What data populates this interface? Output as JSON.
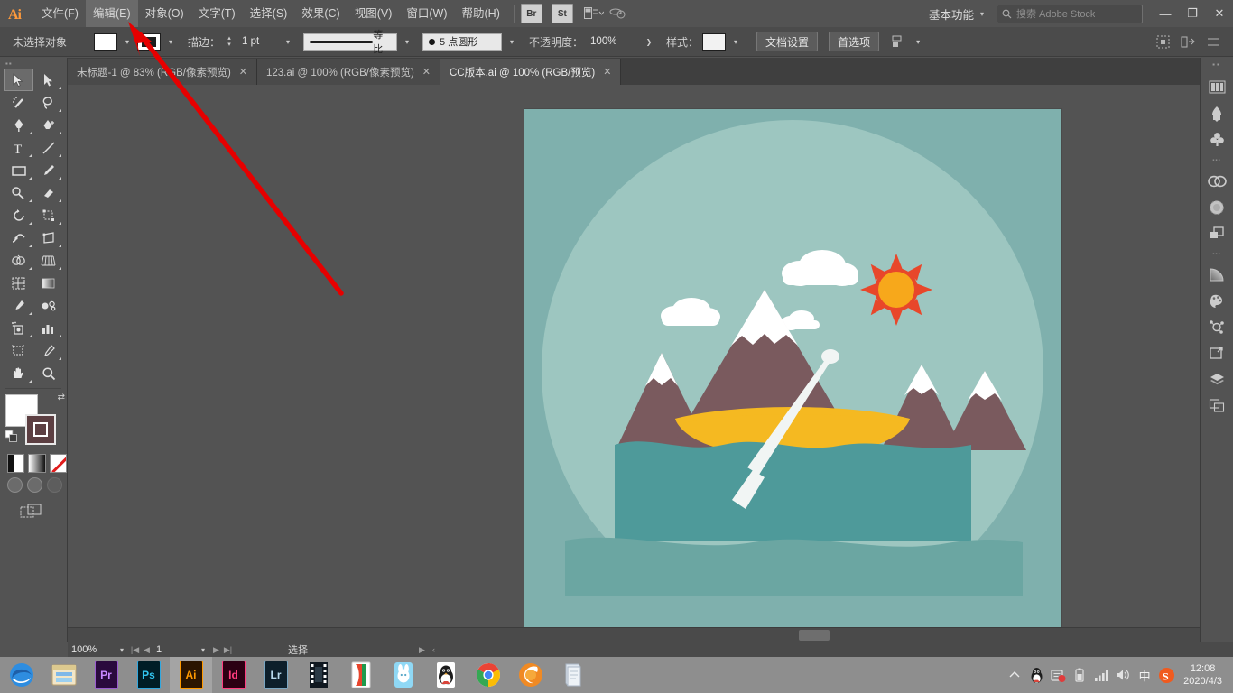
{
  "app": {
    "name": "Adobe Illustrator",
    "logo_text": "Ai"
  },
  "menubar": {
    "items": [
      {
        "label": "文件(F)",
        "highlighted": false
      },
      {
        "label": "编辑(E)",
        "highlighted": true
      },
      {
        "label": "对象(O)",
        "highlighted": false
      },
      {
        "label": "文字(T)",
        "highlighted": false
      },
      {
        "label": "选择(S)",
        "highlighted": false
      },
      {
        "label": "效果(C)",
        "highlighted": false
      },
      {
        "label": "视图(V)",
        "highlighted": false
      },
      {
        "label": "窗口(W)",
        "highlighted": false
      },
      {
        "label": "帮助(H)",
        "highlighted": false
      }
    ],
    "bridge_label": "Br",
    "stock_label": "St",
    "arrange_icon": "arrange-documents-icon",
    "sync_icon": "sync-settings-icon",
    "workspace": "基本功能",
    "search_placeholder": "搜索 Adobe Stock",
    "window_minimize": "—",
    "window_restore": "❐",
    "window_close": "✕"
  },
  "controlbar": {
    "selection_status": "未选择对象",
    "fill_label": "fill-swatch",
    "stroke_label": "stroke-swatch",
    "stroke_text": "描边：",
    "stroke_weight": "1 pt",
    "profile_label": "等比",
    "brush_def": "5 点圆形",
    "opacity_label": "不透明度：",
    "opacity_value": "100%",
    "style_label": "样式：",
    "doc_setup_btn": "文档设置",
    "preferences_btn": "首选项",
    "align_icon": "align-to-selection-icon"
  },
  "tabs": [
    {
      "title": "未标题-1 @ 83% (RGB/像素预览)",
      "active": false,
      "close": "✕"
    },
    {
      "title": "123.ai @ 100% (RGB/像素预览)",
      "active": false,
      "close": "✕"
    },
    {
      "title": "CC版本.ai @ 100% (RGB/预览)",
      "active": true,
      "close": "✕"
    }
  ],
  "toolbar": {
    "tools": [
      {
        "name": "selection-tool",
        "selected": true
      },
      {
        "name": "direct-selection-tool",
        "selected": false
      },
      {
        "name": "magic-wand-tool",
        "selected": false
      },
      {
        "name": "lasso-tool",
        "selected": false
      },
      {
        "name": "pen-tool",
        "selected": false
      },
      {
        "name": "add-anchor-point-tool",
        "selected": false
      },
      {
        "name": "type-tool",
        "selected": false
      },
      {
        "name": "line-segment-tool",
        "selected": false
      },
      {
        "name": "rectangle-tool",
        "selected": false
      },
      {
        "name": "paintbrush-tool",
        "selected": false
      },
      {
        "name": "shaper-tool",
        "selected": false
      },
      {
        "name": "eraser-tool",
        "selected": false
      },
      {
        "name": "rotate-tool",
        "selected": false
      },
      {
        "name": "scale-tool",
        "selected": false
      },
      {
        "name": "width-tool",
        "selected": false
      },
      {
        "name": "free-transform-tool",
        "selected": false
      },
      {
        "name": "shape-builder-tool",
        "selected": false
      },
      {
        "name": "perspective-grid-tool",
        "selected": false
      },
      {
        "name": "mesh-tool",
        "selected": false
      },
      {
        "name": "gradient-tool",
        "selected": false
      },
      {
        "name": "eyedropper-tool",
        "selected": false
      },
      {
        "name": "blend-tool",
        "selected": false
      },
      {
        "name": "symbol-sprayer-tool",
        "selected": false
      },
      {
        "name": "column-graph-tool",
        "selected": false
      },
      {
        "name": "artboard-tool",
        "selected": false
      },
      {
        "name": "slice-tool",
        "selected": false
      },
      {
        "name": "hand-tool",
        "selected": false
      },
      {
        "name": "zoom-tool",
        "selected": false
      }
    ],
    "fill_color": "#FFFFFF",
    "stroke_color": "#5C3F42",
    "draw_modes": [
      "color-mode",
      "gradient-mode",
      "none-mode"
    ],
    "screen_modes": [
      "normal-screen-mode",
      "full-screen-menu-mode",
      "full-screen-mode"
    ]
  },
  "dock": {
    "icons": [
      {
        "name": "libraries-panel-icon"
      },
      {
        "name": "brushes-panel-icon"
      },
      {
        "name": "symbols-panel-icon"
      },
      {
        "name": "creative-cloud-panel-icon"
      },
      {
        "name": "color-guide-panel-icon"
      },
      {
        "name": "pathfinder-panel-icon"
      },
      {
        "name": "gradient-panel-icon"
      },
      {
        "name": "swatches-panel-icon"
      },
      {
        "name": "stroke-panel-icon"
      },
      {
        "name": "transform-panel-icon"
      },
      {
        "name": "layers-panel-icon"
      },
      {
        "name": "artboards-panel-icon"
      }
    ]
  },
  "statusbar": {
    "zoom": "100%",
    "page": "1",
    "tool_status": "选择"
  },
  "canvas": {
    "artboard_bg": "#7FB0AD",
    "inner_circle": "#9DC6C0",
    "mountain_color": "#7A5A5E",
    "water_color": "#4E9A9A",
    "water_front": "#6BA6A2",
    "canoe_color": "#F5B921",
    "sun_core": "#F7A81B",
    "sun_rays": "#E8472A",
    "snow_color": "#FFFFFF",
    "cloud_color": "#FFFFFF"
  },
  "annotation": {
    "color": "#E60000",
    "arrow_from": "378,325",
    "arrow_to": "142,24"
  },
  "taskbar": {
    "items": [
      {
        "name": "edge-browser",
        "label": "",
        "bg": "#1a7fd4"
      },
      {
        "name": "file-explorer",
        "label": "",
        "bg": "#f5c542"
      },
      {
        "name": "premiere-pro",
        "label": "Pr",
        "bg": "#2a0a3d",
        "fg": "#c887ff",
        "border": "#9a5cd0"
      },
      {
        "name": "photoshop",
        "label": "Ps",
        "bg": "#001d26",
        "fg": "#31c5f0",
        "border": "#31a8e0"
      },
      {
        "name": "illustrator",
        "label": "Ai",
        "bg": "#2b1500",
        "fg": "#ff9a00",
        "border": "#ff9a00",
        "active": true
      },
      {
        "name": "indesign",
        "label": "Id",
        "bg": "#2b0013",
        "fg": "#ff3d7f",
        "border": "#ff3d7f"
      },
      {
        "name": "lightroom",
        "label": "Lr",
        "bg": "#0d1f2b",
        "fg": "#b8d9ec",
        "border": "#7aa6c2"
      },
      {
        "name": "video-editor",
        "label": "",
        "bg": "#101820"
      },
      {
        "name": "wps-office",
        "label": "",
        "bg": "#ffffff"
      },
      {
        "name": "qq-pinyin",
        "label": "",
        "bg": "#8fd8f5"
      },
      {
        "name": "qq-messenger",
        "label": "",
        "bg": "#ffffff"
      },
      {
        "name": "chrome-browser",
        "label": "",
        "bg": "#ffffff"
      },
      {
        "name": "firefox-browser",
        "label": "",
        "bg": "#ffffff"
      },
      {
        "name": "notes-app",
        "label": "",
        "bg": "#dfe7ef"
      }
    ],
    "tray": [
      {
        "name": "show-hidden-icons-chevron"
      },
      {
        "name": "qq-tray-icon"
      },
      {
        "name": "notification-tray-icon"
      },
      {
        "name": "battery-icon"
      },
      {
        "name": "network-signal-icon"
      },
      {
        "name": "volume-icon"
      },
      {
        "name": "ime-chinese-icon",
        "label": "中"
      },
      {
        "name": "sogou-input-icon",
        "label": "S"
      }
    ],
    "clock_time": "12:08",
    "clock_date": "2020/4/3"
  }
}
